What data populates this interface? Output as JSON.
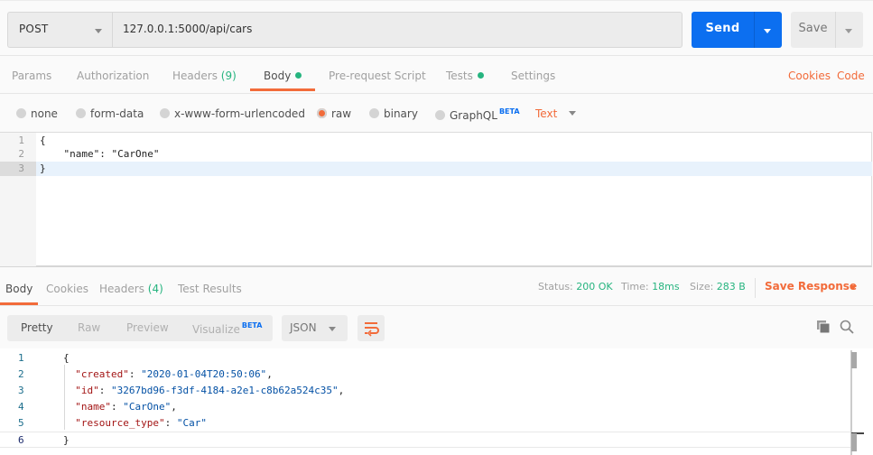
{
  "request": {
    "method": "POST",
    "url": "127.0.0.1:5000/api/cars",
    "send_label": "Send",
    "save_label": "Save"
  },
  "request_tabs": [
    {
      "label": "Params"
    },
    {
      "label": "Authorization"
    },
    {
      "label": "Headers",
      "count": "(9)"
    },
    {
      "label": "Body",
      "active": true,
      "dot": true
    },
    {
      "label": "Pre-request Script"
    },
    {
      "label": "Tests",
      "dot": true
    },
    {
      "label": "Settings"
    }
  ],
  "request_links": {
    "cookies": "Cookies",
    "code": "Code"
  },
  "body_types": [
    {
      "label": "none"
    },
    {
      "label": "form-data"
    },
    {
      "label": "x-www-form-urlencoded"
    },
    {
      "label": "raw",
      "selected": true
    },
    {
      "label": "binary"
    },
    {
      "label": "GraphQL",
      "badge": "BETA"
    }
  ],
  "raw_format": "Text",
  "request_body_lines": [
    {
      "num": "1",
      "text": "{"
    },
    {
      "num": "2",
      "text": "    \"name\": \"CarOne\""
    },
    {
      "num": "3",
      "text": "}"
    }
  ],
  "response_tabs": [
    {
      "label": "Body",
      "active": true
    },
    {
      "label": "Cookies"
    },
    {
      "label": "Headers",
      "count": "(4)"
    },
    {
      "label": "Test Results"
    }
  ],
  "response_meta": {
    "status_label": "Status:",
    "status_value": "200 OK",
    "time_label": "Time:",
    "time_value": "18ms",
    "size_label": "Size:",
    "size_value": "283 B",
    "save_response": "Save Response"
  },
  "view_modes": [
    {
      "label": "Pretty",
      "active": true
    },
    {
      "label": "Raw"
    },
    {
      "label": "Preview"
    },
    {
      "label": "Visualize",
      "badge": "BETA"
    }
  ],
  "response_format": "JSON",
  "response_body_lines": [
    {
      "num": "1",
      "open": "{"
    },
    {
      "num": "2",
      "key": "\"created\"",
      "value": "\"2020-01-04T20:50:06\"",
      "trail": ","
    },
    {
      "num": "3",
      "key": "\"id\"",
      "value": "\"3267bd96-f3df-4184-a2e1-c8b62a524c35\"",
      "trail": ","
    },
    {
      "num": "4",
      "key": "\"name\"",
      "value": "\"CarOne\"",
      "trail": ","
    },
    {
      "num": "5",
      "key": "\"resource_type\"",
      "value": "\"Car\"",
      "trail": ""
    },
    {
      "num": "6",
      "close": "}"
    }
  ],
  "colors": {
    "accent_orange": "#f26b3a",
    "send_blue": "#0c6ff0",
    "success_green": "#26b47f"
  }
}
